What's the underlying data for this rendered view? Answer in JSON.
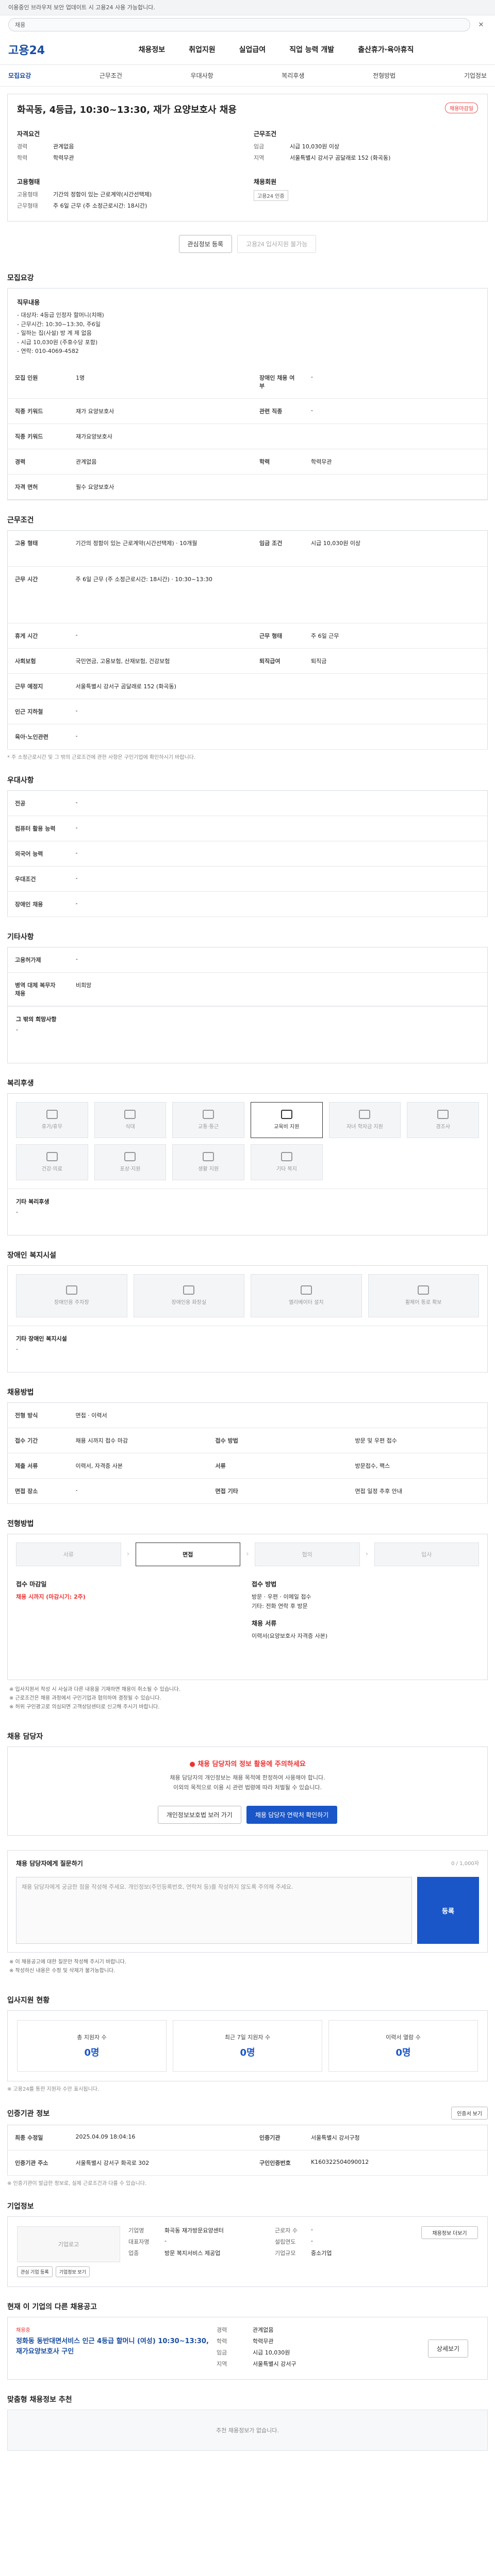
{
  "topbar": {
    "notice": "이용중인 브라우저 보안 업데이트 시 고용24 사용 가능합니다.",
    "search_placeholder": "채용",
    "close": "✕"
  },
  "gnb": {
    "logo": "고용24",
    "items": [
      "채용정보",
      "취업지원",
      "실업급여",
      "직업 능력 개발",
      "출산휴가·육아휴직"
    ]
  },
  "subtabs": [
    "모집요강",
    "근무조건",
    "우대사항",
    "복리후생",
    "전형방법",
    "기업정보"
  ],
  "hero": {
    "title": "화곡동, 4등급, 10:30~13:30, 재가 요양보호사 채용",
    "badge": "채용마감일",
    "left_title": "자격요건",
    "left_rows": [
      {
        "k": "경력",
        "v": "관계없음"
      },
      {
        "k": "학력",
        "v": "학력무관"
      }
    ],
    "right_title": "근무조건",
    "right_rows": [
      {
        "k": "임금",
        "v": "시급 10,030원 이상"
      },
      {
        "k": "지역",
        "v": "서울특별시 강서구 곰달래로 152 (화곡동)"
      }
    ],
    "left_title2": "고용형태",
    "left_rows2": [
      {
        "k": "고용형태",
        "v": "기간의 정함이 있는 근로계약(시간선택제)"
      },
      {
        "k": "근무형태",
        "v": "주 6일 근무 (주 소정근로시간: 18시간)"
      }
    ],
    "right_title2": "채용회원",
    "right_btn": "고용24 인증"
  },
  "actions": {
    "scrap": "관심정보 등록",
    "apply": "고용24 입사지원 불가능"
  },
  "recruit": {
    "title": "모집요강",
    "duty_label": "직무내용",
    "duty_lines": [
      "- 대상자: 4등급 인정자 할머니(치매)",
      "- 근무시간: 10:30~13:30, 주6일",
      "- 일하는 집(사설) 방 계 제 없음",
      "- 시급 10,030원 (주휴수당 포함)",
      "- 연락: 010-4069-4582"
    ],
    "rows": [
      {
        "k": "모집 인원",
        "v": "1명",
        "k2": "장애인 채용 여부",
        "v2": "-"
      },
      {
        "k": "직종 키워드",
        "v": "재가 요양보호사",
        "k2": "관련 직종",
        "v2": "-"
      },
      {
        "k": "직종 키워드",
        "v": "재가요양보호사",
        "k2": "",
        "v2": ""
      },
      {
        "k": "경력",
        "v": "관계없음",
        "k2": "학력",
        "v2": "학력무관"
      },
      {
        "k": "자격 면허",
        "v": "필수  요양보호사",
        "k2": "",
        "v2": ""
      }
    ]
  },
  "conditions": {
    "title": "근무조건",
    "rows": [
      {
        "k": "고용 형태",
        "v": "기간의 정함이 있는 근로계약(시간선택제) · 10개월",
        "k2": "임금 조건",
        "v2": "시급 10,030원 이상"
      },
      {
        "k": "근무 시간",
        "v": "주 6일 근무 (주 소정근로시간: 18시간) · 10:30~13:30",
        "k2": "",
        "v2": ""
      },
      {
        "k": "휴게 시간",
        "v": "-",
        "k2": "근무 형태",
        "v2": "주 6일 근무"
      },
      {
        "k": "사회보험",
        "v": "국민연금, 고용보험, 산재보험, 건강보험",
        "k2": "퇴직급여",
        "v2": "퇴직금"
      },
      {
        "k": "근무 예정지",
        "v": "서울특별시 강서구 곰달래로 152 (화곡동)",
        "k2": "",
        "v2": ""
      },
      {
        "k": "인근 지하철",
        "v": "-",
        "k2": "",
        "v2": ""
      },
      {
        "k": "육아·노인관련",
        "v": "-",
        "k2": "",
        "v2": ""
      }
    ],
    "note": "* 주 소정근로시간 및 그 밖의 근로조건에 관한 사항은 구인기업에 확인하시기 바랍니다."
  },
  "preferred": {
    "title": "우대사항",
    "rows": [
      {
        "k": "전공",
        "v": "-"
      },
      {
        "k": "컴퓨터 활용 능력",
        "v": "-"
      },
      {
        "k": "외국어 능력",
        "v": "-"
      },
      {
        "k": "우대조건",
        "v": "-"
      },
      {
        "k": "장애인 채용",
        "v": "-"
      }
    ]
  },
  "others": {
    "title": "기타사항",
    "rows": [
      {
        "k": "고용허가제",
        "v": "-"
      },
      {
        "k": "병역 대체 복무자 채용",
        "v": "비희망"
      }
    ],
    "extra_label": "그 밖의 희망사항",
    "extra_value": "-"
  },
  "welfare": {
    "title": "복리후생",
    "items": [
      {
        "label": "휴가/휴무",
        "on": false
      },
      {
        "label": "식대",
        "on": false
      },
      {
        "label": "교통·통근",
        "on": false
      },
      {
        "label": "교육비 지원",
        "on": true
      },
      {
        "label": "자녀 학자금 지원",
        "on": false
      },
      {
        "label": "경조사",
        "on": false
      },
      {
        "label": "건강·의료",
        "on": false
      },
      {
        "label": "포상·지원",
        "on": false
      },
      {
        "label": "생활 지원",
        "on": false
      },
      {
        "label": "기타 복지",
        "on": false
      }
    ],
    "extra_label": "기타 복리후생",
    "extra_value": "-"
  },
  "disability": {
    "title": "장애인 복지시설",
    "items": [
      "장애인용 주차장",
      "장애인용 화장실",
      "엘리베이터 설치",
      "휠체어 통로 확보"
    ],
    "extra_label": "기타 장애인 복지시설",
    "extra_value": "-"
  },
  "method": {
    "title": "채용방법",
    "rows": [
      {
        "k": "전형 방식",
        "v": "면접 · 이력서",
        "k2": "",
        "v2": ""
      },
      {
        "k": "접수 기간",
        "v": "채용 시까지 접수 마감",
        "k2": "접수 방법",
        "v2": "방문 및 우편 접수"
      },
      {
        "k": "제출 서류",
        "v": "이력서, 자격증 사본",
        "k2": "서류",
        "v2": "방문접수, 팩스"
      },
      {
        "k": "면접 장소",
        "v": "-",
        "k2": "면접 기타",
        "v2": "면접 일정 추후 안내"
      }
    ]
  },
  "process": {
    "title": "전형방법",
    "steps": [
      "서류",
      "면접",
      "협의",
      "입사"
    ],
    "active": 1,
    "apply_title": "접수 마감일",
    "apply_date": "채용 시까지 (마감시기: 2주)",
    "docs_title": "접수 방법",
    "docs_lines": [
      "방문 · 우편 · 이메일 접수",
      "기타: 전화 연락 후 방문"
    ],
    "contact_title": "채용 서류",
    "contact_value": "이력서(요양보호사 자격증 사본)",
    "bullets": [
      "※ 입사지원서 작성 시 사실과 다른 내용을 기재하면 채용이 취소될 수 있습니다.",
      "※ 근로조건은 채용 과정에서 구인기업과 협의하여 결정될 수 있습니다.",
      "※ 허위 구인광고로 의심되면 고객상담센터로 신고해 주시기 바랍니다."
    ]
  },
  "contact": {
    "title": "채용 담당자",
    "alert": "채용 담당자의 정보 활용에 주의하세요",
    "body": "채용 담당자의 개인정보는 채용 목적에 한정하여 사용해야 합니다.",
    "body2": "이외의 목적으로 이용 시 관련 법령에 따라 처벌될 수 있습니다.",
    "btn1": "개인정보보호법 보러 가기",
    "btn2": "채용 담당자 연락처 확인하기"
  },
  "inquiry": {
    "title": "채용 담당자에게 질문하기",
    "counter": "0 / 1,000자",
    "placeholder": "채용 담당자에게 궁금한 점을 작성해 주세요. 개인정보(주민등록번호, 연락처 등)를 작성하지 않도록 주의해 주세요.",
    "submit": "등록",
    "notes": [
      "※ 이 채용공고에 대한 질문만 작성해 주시기 바랍니다.",
      "※ 작성하신 내용은 수정 및 삭제가 불가능합니다."
    ]
  },
  "applicants": {
    "title": "입사지원 현황",
    "items": [
      {
        "label": "총 지원자 수",
        "value": "0명"
      },
      {
        "label": "최근 7일 지원자 수",
        "value": "0명"
      },
      {
        "label": "이력서 열람 수",
        "value": "0명"
      }
    ],
    "note": "※ 고용24를 통한 지원자 수만 표시됩니다."
  },
  "reg": {
    "title": "인증기관 정보",
    "btn": "인증서 보기",
    "rows": [
      {
        "k": "최종 수정일",
        "v": "2025.04.09 18:04:16",
        "k2": "인증기관",
        "v2": "서울특별시 강서구청"
      },
      {
        "k": "인증기관 주소",
        "v": "서울특별시 강서구 화곡로 302",
        "k2": "구인인증번호",
        "v2": "K160322504090012"
      }
    ],
    "note": "※ 인증기관이 발급한 정보로, 실제 근로조건과 다를 수 있습니다."
  },
  "company": {
    "title": "기업정보",
    "logo": "기업로고",
    "btn1": "관심 기업 등록",
    "btn2": "기업정보 보기",
    "rows1": [
      {
        "k": "기업명",
        "v": "화곡동 재가방문요양센터"
      },
      {
        "k": "대표자명",
        "v": "-"
      },
      {
        "k": "업종",
        "v": "방문 복지서비스 제공업"
      }
    ],
    "rows2": [
      {
        "k": "근로자 수",
        "v": "-"
      },
      {
        "k": "설립연도",
        "v": "-"
      },
      {
        "k": "기업규모",
        "v": "중소기업"
      }
    ],
    "side_btn": "채용정보 더보기"
  },
  "other_jobs": {
    "title": "현재 이 기업의 다른 채용공고",
    "card_label": "채용중",
    "card_title": "정화동 동반대면서비스 인근 4등급 할머니 (여성) 10:30~13:30, 재가요양보호사 구인",
    "rows": [
      {
        "k": "경력",
        "v": "관계없음"
      },
      {
        "k": "학력",
        "v": "학력무관"
      },
      {
        "k": "임금",
        "v": "시급 10,030원"
      },
      {
        "k": "지역",
        "v": "서울특별시 강서구"
      }
    ],
    "btn": "상세보기"
  },
  "recommend": {
    "title": "맞춤형 채용정보 추천",
    "empty": "추천 채용정보가 없습니다."
  }
}
